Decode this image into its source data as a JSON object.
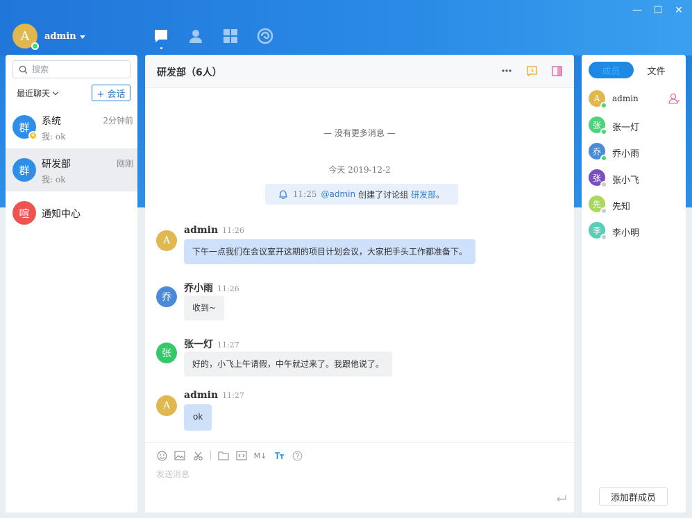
{
  "window": {
    "minimize": "—",
    "maximize": "☐",
    "close": "✕"
  },
  "user": {
    "avatar_letter": "A",
    "name": "admin"
  },
  "sidebar": {
    "search_placeholder": "搜索",
    "recent_label": "最近聊天",
    "new_chat_label": "+ 会话",
    "conversations": [
      {
        "avatar": "群",
        "name": "系统",
        "time": "2分钟前",
        "preview": "我: ok",
        "color": "#2f8ee8"
      },
      {
        "avatar": "群",
        "name": "研发部",
        "time": "刚刚",
        "preview": "我: ok",
        "color": "#2f8ee8"
      },
      {
        "avatar": "喧",
        "name": "通知中心",
        "time": "",
        "preview": "",
        "color": "#ef5350"
      }
    ]
  },
  "chat": {
    "title": "研发部（6人）",
    "no_more": "— 没有更多消息 —",
    "date": "今天 2019-12-2",
    "notice": {
      "time": "11:25",
      "mention": "@admin",
      "text": "创建了讨论组",
      "group": "研发部",
      "end": "。"
    },
    "messages": [
      {
        "avatar": "A",
        "sender": "admin",
        "time": "11:26",
        "text": "下午一点我们在会议室开这期的项目计划会议，大家把手头工作都准备下。",
        "mine": true,
        "color": "#e1b84f"
      },
      {
        "avatar": "乔",
        "sender": "乔小雨",
        "time": "11:26",
        "text": "收到~",
        "mine": false,
        "color": "#4a8ad8"
      },
      {
        "avatar": "张",
        "sender": "张一灯",
        "time": "11:27",
        "text": "好的，小飞上午请假，中午就过来了。我跟他说了。",
        "mine": false,
        "color": "#35c86a"
      },
      {
        "avatar": "A",
        "sender": "admin",
        "time": "11:27",
        "text": "ok",
        "mine": true,
        "color": "#e1b84f"
      }
    ],
    "input_placeholder": "发送消息",
    "toolbar_md": "M↓"
  },
  "members_panel": {
    "tab_members": "成员",
    "tab_files": "文件",
    "members": [
      {
        "avatar": "A",
        "name": "admin",
        "color": "#e1b84f",
        "status": "#3ddc6c"
      },
      {
        "avatar": "张",
        "name": "张一灯",
        "color": "#4fd37a",
        "status": "#3ddc6c"
      },
      {
        "avatar": "乔",
        "name": "乔小雨",
        "color": "#4a8ad8",
        "status": "#3ddc6c"
      },
      {
        "avatar": "张",
        "name": "张小飞",
        "color": "#7c4fc1",
        "status": "#c8cbcf"
      },
      {
        "avatar": "先",
        "name": "先知",
        "color": "#a8d95a",
        "status": "#c8cbcf"
      },
      {
        "avatar": "李",
        "name": "李小明",
        "color": "#58cdb8",
        "status": "#c8cbcf"
      }
    ],
    "add_member": "添加群成员"
  }
}
